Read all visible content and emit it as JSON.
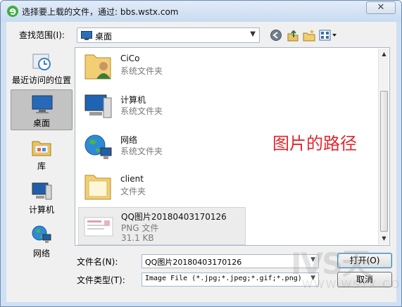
{
  "window": {
    "title": "选择要上载的文件，通过: bbs.wstx.com",
    "close_label": "✕"
  },
  "lookin": {
    "label": "查找范围(I):",
    "value": "桌面",
    "dropdown_arrow": "▼"
  },
  "toolbar": {
    "icons": [
      "back-icon",
      "up-folder-icon",
      "new-folder-icon",
      "view-menu-icon"
    ]
  },
  "places": [
    {
      "label": "最近访问的位置",
      "icon": "recent-places-icon"
    },
    {
      "label": "桌面",
      "icon": "desktop-icon",
      "selected": true
    },
    {
      "label": "库",
      "icon": "libraries-icon"
    },
    {
      "label": "计算机",
      "icon": "computer-icon"
    },
    {
      "label": "网络",
      "icon": "network-icon"
    }
  ],
  "files": [
    {
      "name": "CiCo",
      "type": "系统文件夹",
      "icon": "user-folder-icon"
    },
    {
      "name": "计算机",
      "type": "系统文件夹",
      "icon": "computer-icon"
    },
    {
      "name": "网络",
      "type": "系统文件夹",
      "icon": "network-icon"
    },
    {
      "name": "client",
      "type": "文件夹",
      "icon": "folder-icon"
    },
    {
      "name": "QQ图片20180403170126",
      "type": "PNG 文件",
      "size": "31.1 KB",
      "icon": "image-thumbnail-icon",
      "selected": true
    }
  ],
  "annotation": "图片的路径",
  "filename": {
    "label": "文件名(N):",
    "value": "QQ图片20180403170126"
  },
  "filetype": {
    "label": "文件类型(T):",
    "value": "Image File (*.jpg;*.jpeg;*.gif;*.png)"
  },
  "buttons": {
    "open": "打开(O)",
    "cancel": "取消"
  },
  "watermark": {
    "brand": "ⅣS天",
    "url": "WWW.WSTX.COM"
  },
  "colors": {
    "annotation": "#e3262d",
    "titlebar": "#c8dbf1",
    "selection": "#c3c3c3"
  }
}
